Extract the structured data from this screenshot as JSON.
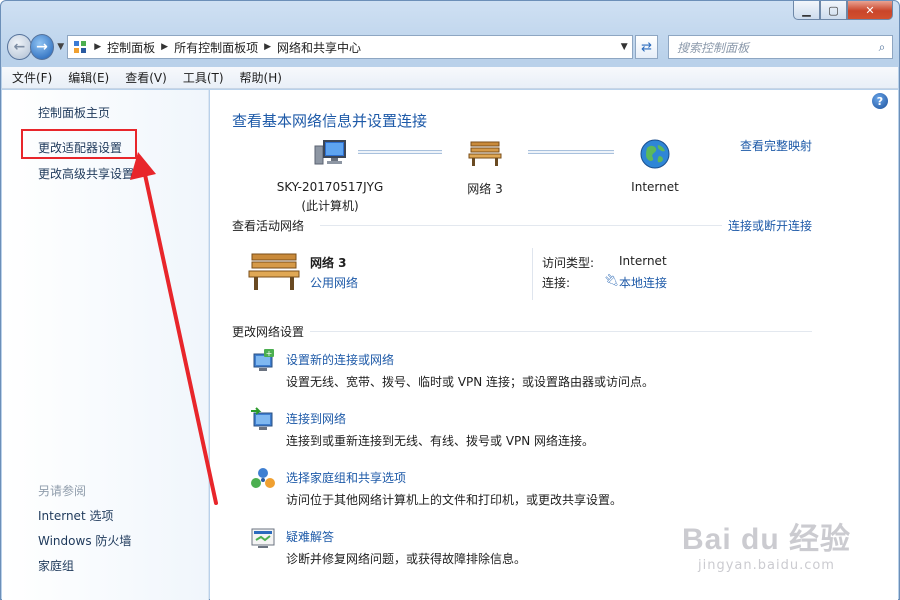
{
  "window": {
    "controls": {
      "minimize": "▁",
      "maximize": "▢",
      "close": "✕"
    }
  },
  "nav": {
    "back_icon": "back-arrow-icon",
    "forward_icon": "forward-arrow-icon",
    "breadcrumbs": [
      "控制面板",
      "所有控制面板项",
      "网络和共享中心"
    ],
    "search_placeholder": "搜索控制面板"
  },
  "menu": [
    "文件(F)",
    "编辑(E)",
    "查看(V)",
    "工具(T)",
    "帮助(H)"
  ],
  "sidebar": {
    "links": [
      "控制面板主页",
      "更改适配器设置",
      "更改高级共享设置"
    ],
    "see_also_header": "另请参阅",
    "see_also": [
      "Internet 选项",
      "Windows 防火墙",
      "家庭组"
    ]
  },
  "main": {
    "title": "查看基本网络信息并设置连接",
    "full_map_link": "查看完整映射",
    "map": {
      "computer_name": "SKY-20170517JYG",
      "computer_sub": "(此计算机)",
      "network": "网络  3",
      "internet": "Internet"
    },
    "active": {
      "section_title": "查看活动网络",
      "connect_link": "连接或断开连接",
      "network_name": "网络  3",
      "network_type": "公用网络",
      "access_type_label": "访问类型:",
      "access_type_value": "Internet",
      "connection_label": "连接:",
      "connection_value": "本地连接"
    },
    "change": {
      "section_title": "更改网络设置",
      "tasks": [
        {
          "title": "设置新的连接或网络",
          "desc": "设置无线、宽带、拨号、临时或 VPN 连接；或设置路由器或访问点。",
          "icon": "new-connection-icon"
        },
        {
          "title": "连接到网络",
          "desc": "连接到或重新连接到无线、有线、拨号或 VPN 网络连接。",
          "icon": "connect-network-icon"
        },
        {
          "title": "选择家庭组和共享选项",
          "desc": "访问位于其他网络计算机上的文件和打印机，或更改共享设置。",
          "icon": "homegroup-icon"
        },
        {
          "title": "疑难解答",
          "desc": "诊断并修复网络问题，或获得故障排除信息。",
          "icon": "troubleshoot-icon"
        }
      ]
    },
    "help": "?"
  },
  "watermark": {
    "logo": "Bai du 经验",
    "sub": "jingyan.baidu.com"
  },
  "colors": {
    "link": "#1e5aa8",
    "highlight": "#e8262b",
    "sidebar_bg": "#f0f6fc"
  }
}
